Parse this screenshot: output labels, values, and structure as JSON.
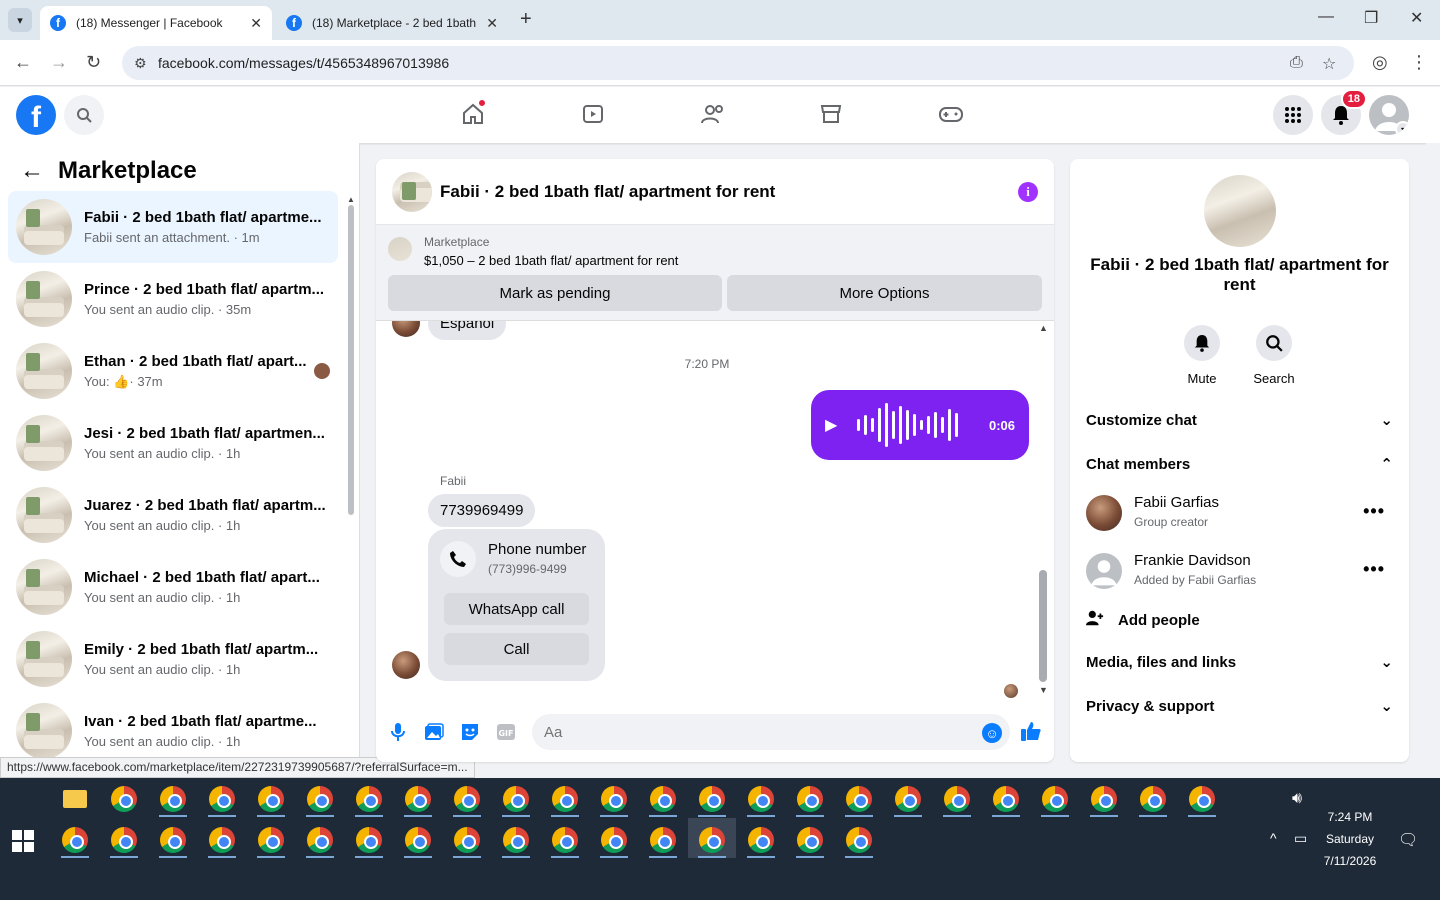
{
  "browser": {
    "tabs": [
      {
        "label": "(18) Messenger | Facebook",
        "active": true
      },
      {
        "label": "(18) Marketplace - 2 bed 1bath",
        "active": false
      }
    ],
    "url": "facebook.com/messages/t/4565348967013986",
    "status_url": "https://www.facebook.com/marketplace/item/2272319739905687/?referralSurface=m..."
  },
  "fb": {
    "notifications_badge": "18"
  },
  "left": {
    "title": "Marketplace",
    "conversations": [
      {
        "name": "Fabii · 2 bed 1bath flat/ apartme...",
        "sub": "Fabii sent an attachment. · 1m",
        "active": true
      },
      {
        "name": "Prince · 2 bed 1bath flat/ apartm...",
        "sub": "You sent an audio clip. · 35m"
      },
      {
        "name": "Ethan · 2 bed 1bath flat/ apart...",
        "sub_prefix": "You:",
        "sub": "· 37m",
        "thumbs": true
      },
      {
        "name": "Jesi · 2 bed 1bath flat/ apartmen...",
        "sub": "You sent an audio clip. · 1h"
      },
      {
        "name": "Juarez · 2 bed 1bath flat/ apartm...",
        "sub": "You sent an audio clip. · 1h"
      },
      {
        "name": "Michael · 2 bed 1bath flat/ apart...",
        "sub": "You sent an audio clip. · 1h"
      },
      {
        "name": "Emily · 2 bed 1bath flat/ apartm...",
        "sub": "You sent an audio clip. · 1h"
      },
      {
        "name": "Ivan · 2 bed 1bath flat/ apartme...",
        "sub": "You sent an audio clip. · 1h"
      }
    ]
  },
  "chat": {
    "title": "Fabii · 2 bed 1bath flat/ apartment for rent",
    "marketplace_label": "Marketplace",
    "listing": "$1,050 – 2 bed 1bath flat/ apartment for rent",
    "mark_pending": "Mark as pending",
    "more_options": "More Options",
    "partial_msg": "Español",
    "timestamp": "7:20 PM",
    "audio_duration": "0:06",
    "sender": "Fabii",
    "phone_msg": "7739969499",
    "phone_card": {
      "title": "Phone number",
      "number": "(773)996-9499",
      "whatsapp": "WhatsApp call",
      "call": "Call"
    },
    "input_placeholder": "Aa",
    "accent": "#7e22f2"
  },
  "info": {
    "title": "Fabii · 2 bed 1bath flat/ apartment for rent",
    "mute": "Mute",
    "search": "Search",
    "customize": "Customize chat",
    "members_header": "Chat members",
    "members": [
      {
        "name": "Fabii Garfias",
        "role": "Group creator"
      },
      {
        "name": "Frankie Davidson",
        "role": "Added by Fabii Garfias"
      }
    ],
    "add_people": "Add people",
    "media": "Media, files and links",
    "privacy": "Privacy & support"
  },
  "taskbar": {
    "time": "7:24 PM",
    "day": "Saturday",
    "date": "7/11/2026"
  }
}
